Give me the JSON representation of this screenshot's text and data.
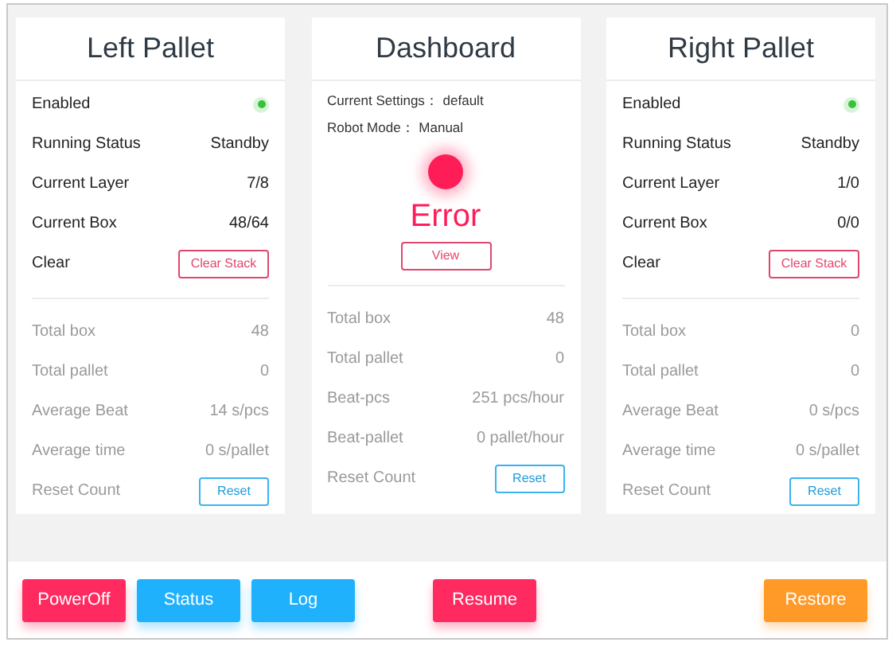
{
  "panels": [
    {
      "kind": "pallet",
      "title": "Left Pallet",
      "status_rows": [
        {
          "kind": "indicator",
          "label": "Enabled",
          "on": true
        },
        {
          "kind": "text",
          "label": "Running Status",
          "value": "Standby"
        },
        {
          "kind": "text",
          "label": "Current Layer",
          "value": "7/8"
        },
        {
          "kind": "text",
          "label": "Current Box",
          "value": "48/64"
        },
        {
          "kind": "button",
          "label": "Clear",
          "button": "Clear Stack"
        }
      ],
      "stats": [
        {
          "kind": "text",
          "label": "Total box",
          "value": "48"
        },
        {
          "kind": "text",
          "label": "Total pallet",
          "value": "0"
        },
        {
          "kind": "text",
          "label": "Average Beat",
          "value": "14 s/pcs"
        },
        {
          "kind": "text",
          "label": "Average time",
          "value": "0 s/pallet"
        },
        {
          "kind": "button",
          "label": "Reset Count",
          "button": "Reset"
        }
      ]
    },
    {
      "kind": "dashboard",
      "title": "Dashboard",
      "info": [
        "Current Settings： default",
        "Robot Mode： Manual"
      ],
      "state": {
        "label": "Error",
        "color": "#ff1d58"
      },
      "button": "View",
      "stats": [
        {
          "kind": "text",
          "label": "Total box",
          "value": "48"
        },
        {
          "kind": "text",
          "label": "Total pallet",
          "value": "0"
        },
        {
          "kind": "text",
          "label": "Beat-pcs",
          "value": "251 pcs/hour"
        },
        {
          "kind": "text",
          "label": "Beat-pallet",
          "value": "0 pallet/hour"
        },
        {
          "kind": "button",
          "label": "Reset Count",
          "button": "Reset"
        }
      ]
    },
    {
      "kind": "pallet",
      "title": "Right Pallet",
      "status_rows": [
        {
          "kind": "indicator",
          "label": "Enabled",
          "on": true
        },
        {
          "kind": "text",
          "label": "Running Status",
          "value": "Standby"
        },
        {
          "kind": "text",
          "label": "Current Layer",
          "value": "1/0"
        },
        {
          "kind": "text",
          "label": "Current Box",
          "value": "0/0"
        },
        {
          "kind": "button",
          "label": "Clear",
          "button": "Clear Stack"
        }
      ],
      "stats": [
        {
          "kind": "text",
          "label": "Total box",
          "value": "0"
        },
        {
          "kind": "text",
          "label": "Total pallet",
          "value": "0"
        },
        {
          "kind": "text",
          "label": "Average Beat",
          "value": "0 s/pcs"
        },
        {
          "kind": "text",
          "label": "Average time",
          "value": "0 s/pallet"
        },
        {
          "kind": "button",
          "label": "Reset Count",
          "button": "Reset"
        }
      ]
    }
  ],
  "actions": [
    {
      "label": "PowerOff",
      "color": "#ff2a5f"
    },
    {
      "label": "Status",
      "color": "#1fb1fb"
    },
    {
      "label": "Log",
      "color": "#1fb1fb"
    },
    {
      "label": "Resume",
      "color": "#ff2a5f"
    },
    {
      "label": "Restore",
      "color": "#ff9a28"
    }
  ]
}
